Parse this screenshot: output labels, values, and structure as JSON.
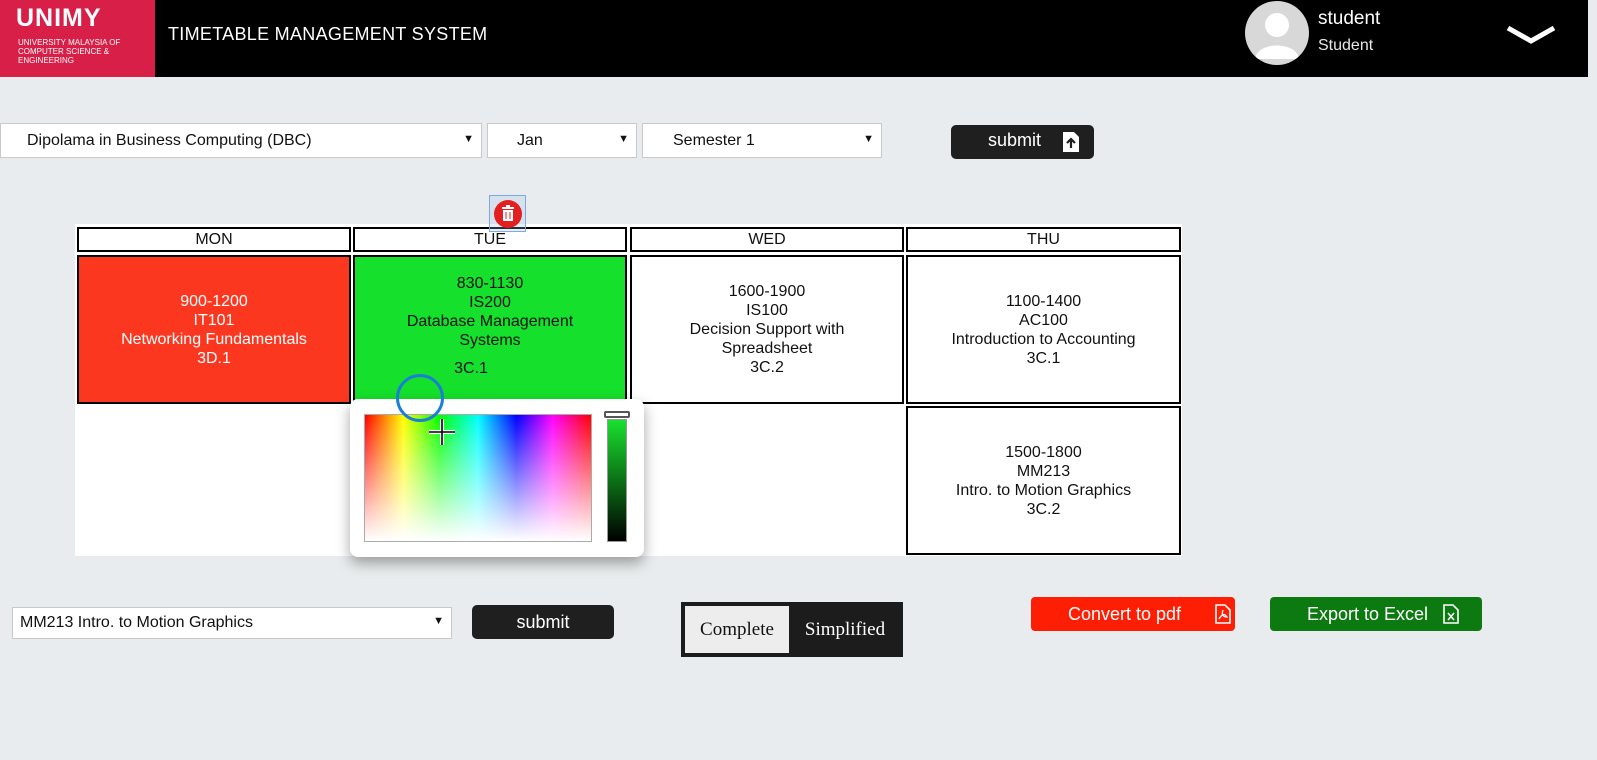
{
  "header": {
    "logo_main": "UNIMY",
    "logo_sub": "UNIVERSITY MALAYSIA OF COMPUTER SCIENCE & ENGINEERING",
    "title": "TIMETABLE MANAGEMENT SYSTEM",
    "user_name": "student",
    "user_role": "Student"
  },
  "filters": {
    "programme": "Dipolama in Business Computing (DBC)",
    "month": "Jan",
    "semester": "Semester 1",
    "submit_label": "submit"
  },
  "timetable": {
    "days": [
      "MON",
      "TUE",
      "WED",
      "THU"
    ],
    "classes": [
      {
        "time": "900-1200",
        "code": "IT101",
        "title": "Networking Fundamentals",
        "room": "3D.1",
        "color": "#fb3720"
      },
      {
        "time": "830-1130",
        "code": "IS200",
        "title": "Database Management Systems",
        "room": "3C.1",
        "color": "#15e02b"
      },
      {
        "time": "1600-1900",
        "code": "IS100",
        "title": "Decision Support with Spreadsheet",
        "room": "3C.2",
        "color": "#ffffff"
      },
      {
        "time": "1100-1400",
        "code": "AC100",
        "title": "Introduction to Accounting",
        "room": "3C.1",
        "color": "#ffffff"
      },
      {
        "time": "1500-1800",
        "code": "MM213",
        "title": "Intro. to Motion Graphics",
        "room": "3C.2",
        "color": "#ffffff"
      }
    ]
  },
  "subject_select": {
    "value": "MM213 Intro. to Motion Graphics",
    "submit_label": "submit"
  },
  "view_toggle": {
    "complete_label": "Complete",
    "simplified_label": "Simplified"
  },
  "actions": {
    "pdf_label": "Convert to pdf",
    "excel_label": "Export to Excel",
    "pdf_color": "#fe1e03",
    "excel_color": "#0c7a11"
  }
}
